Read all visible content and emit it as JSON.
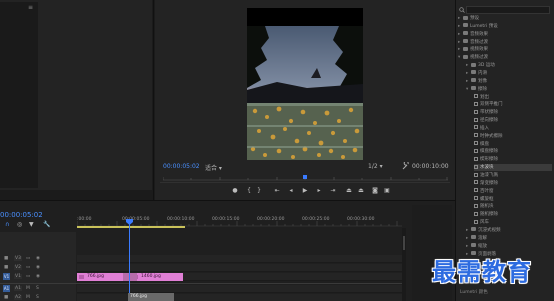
{
  "program_monitor": {
    "current_timecode": "00:00:05:02",
    "fit_select": "适合",
    "resolution_select": "1/2",
    "duration_timecode": "00:00:10:00"
  },
  "effects_panel": {
    "items": [
      {
        "label": "预设",
        "type": "folder",
        "expanded": false
      },
      {
        "label": "Lumetri 预设",
        "type": "folder",
        "expanded": false
      },
      {
        "label": "音频效果",
        "type": "folder",
        "expanded": false
      },
      {
        "label": "音频过渡",
        "type": "folder",
        "expanded": false
      },
      {
        "label": "视频效果",
        "type": "folder",
        "expanded": false
      },
      {
        "label": "视频过渡",
        "type": "folder",
        "expanded": true
      },
      {
        "label": "3D 运动",
        "type": "folder",
        "expanded": false
      },
      {
        "label": "内滑",
        "type": "folder",
        "expanded": false
      },
      {
        "label": "划像",
        "type": "folder",
        "expanded": false
      },
      {
        "label": "擦除",
        "type": "folder",
        "expanded": true
      },
      {
        "label": "划出",
        "type": "effect"
      },
      {
        "label": "双侧平推门",
        "type": "effect"
      },
      {
        "label": "带状擦除",
        "type": "effect"
      },
      {
        "label": "径向擦除",
        "type": "effect"
      },
      {
        "label": "插入",
        "type": "effect"
      },
      {
        "label": "时钟式擦除",
        "type": "effect"
      },
      {
        "label": "棋盘",
        "type": "effect"
      },
      {
        "label": "棋盘擦除",
        "type": "effect"
      },
      {
        "label": "楔形擦除",
        "type": "effect"
      },
      {
        "label": "水波块",
        "type": "effect",
        "selected": true
      },
      {
        "label": "油漆飞溅",
        "type": "effect"
      },
      {
        "label": "渐变擦除",
        "type": "effect"
      },
      {
        "label": "百叶窗",
        "type": "effect"
      },
      {
        "label": "螺旋框",
        "type": "effect"
      },
      {
        "label": "随机块",
        "type": "effect"
      },
      {
        "label": "随机擦除",
        "type": "effect"
      },
      {
        "label": "风车",
        "type": "effect"
      },
      {
        "label": "沉浸式视频",
        "type": "folder",
        "expanded": false
      },
      {
        "label": "溶解",
        "type": "folder",
        "expanded": false
      },
      {
        "label": "缩放",
        "type": "folder",
        "expanded": false
      },
      {
        "label": "页面剥落",
        "type": "folder",
        "expanded": false
      }
    ],
    "footer": "Lumetri 颜色"
  },
  "timeline": {
    "timecode": "00:00:05:02",
    "ruler_ticks": [
      ":00:00",
      "00:00:05:00",
      "00:00:10:00",
      "00:00:15:00",
      "00:00:20:00",
      "00:00:25:00",
      "00:00:30:00"
    ],
    "tracks": [
      {
        "name": "V3"
      },
      {
        "name": "V2"
      },
      {
        "name": "V1",
        "target": "V1"
      },
      {
        "name": "A1",
        "target": "A1"
      },
      {
        "name": "A2"
      }
    ],
    "clips": [
      {
        "label": "766.jpg"
      },
      {
        "label": "1460.jpg"
      }
    ],
    "dragged_clip": "766.jpg"
  },
  "watermark": "最需教育",
  "colors": {
    "accent": "#4a90ff",
    "clip": "#e07fd5",
    "workarea": "#c9c25a"
  }
}
